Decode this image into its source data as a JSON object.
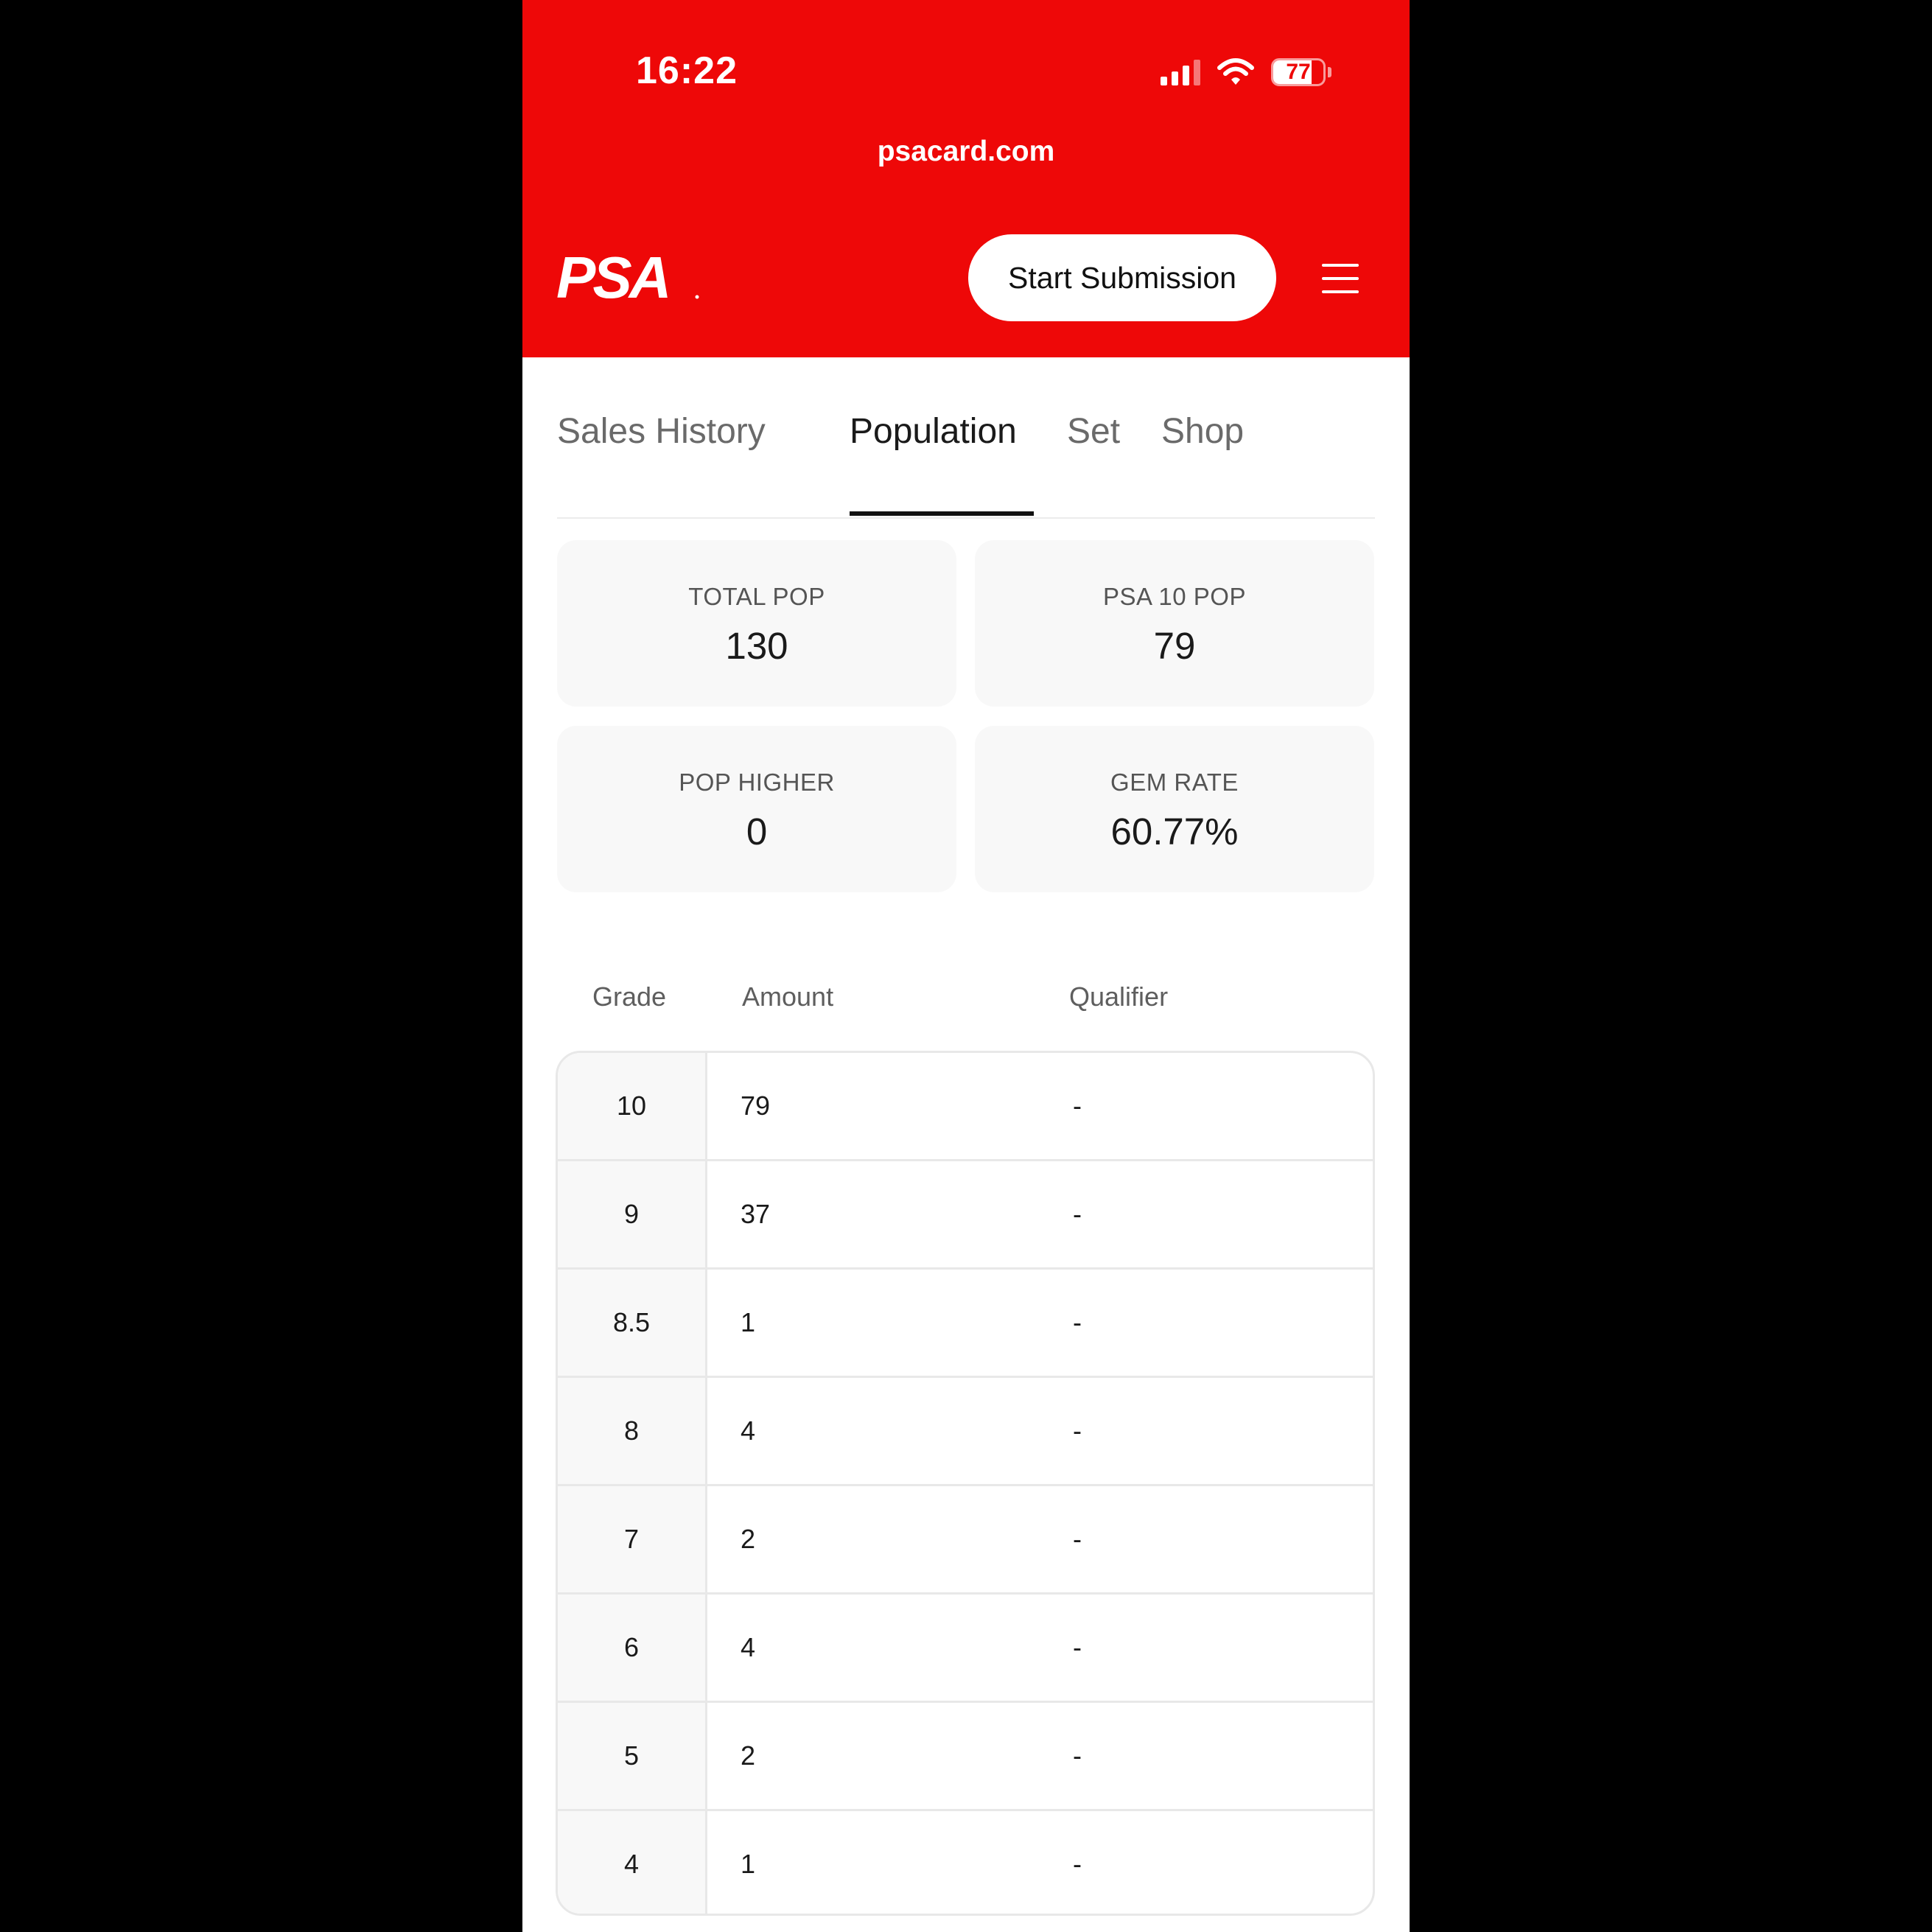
{
  "status_bar": {
    "time": "16:22",
    "battery_level": "77"
  },
  "browser": {
    "url": "psacard.com"
  },
  "header": {
    "logo_text": "PSA",
    "start_submission_label": "Start Submission"
  },
  "colors": {
    "brand_red": "#ee0808",
    "text_dark": "#1a1a1a",
    "text_muted": "#6a6a6a",
    "card_bg": "#f8f8f8"
  },
  "tabs": [
    {
      "label": "Sales History",
      "active": false
    },
    {
      "label": "Population",
      "active": true
    },
    {
      "label": "Set",
      "active": false
    },
    {
      "label": "Shop",
      "active": false
    }
  ],
  "stats": [
    {
      "label": "TOTAL POP",
      "value": "130"
    },
    {
      "label": "PSA 10 POP",
      "value": "79"
    },
    {
      "label": "POP HIGHER",
      "value": "0"
    },
    {
      "label": "GEM RATE",
      "value": "60.77%"
    }
  ],
  "population_table": {
    "headers": {
      "grade": "Grade",
      "amount": "Amount",
      "qualifier": "Qualifier"
    },
    "rows": [
      {
        "grade": "10",
        "amount": "79",
        "qualifier": "-"
      },
      {
        "grade": "9",
        "amount": "37",
        "qualifier": "-"
      },
      {
        "grade": "8.5",
        "amount": "1",
        "qualifier": "-"
      },
      {
        "grade": "8",
        "amount": "4",
        "qualifier": "-"
      },
      {
        "grade": "7",
        "amount": "2",
        "qualifier": "-"
      },
      {
        "grade": "6",
        "amount": "4",
        "qualifier": "-"
      },
      {
        "grade": "5",
        "amount": "2",
        "qualifier": "-"
      },
      {
        "grade": "4",
        "amount": "1",
        "qualifier": "-"
      }
    ]
  },
  "icons": [
    "signal-icon",
    "wifi-icon",
    "battery-icon",
    "psa-logo",
    "hamburger-menu-icon"
  ]
}
